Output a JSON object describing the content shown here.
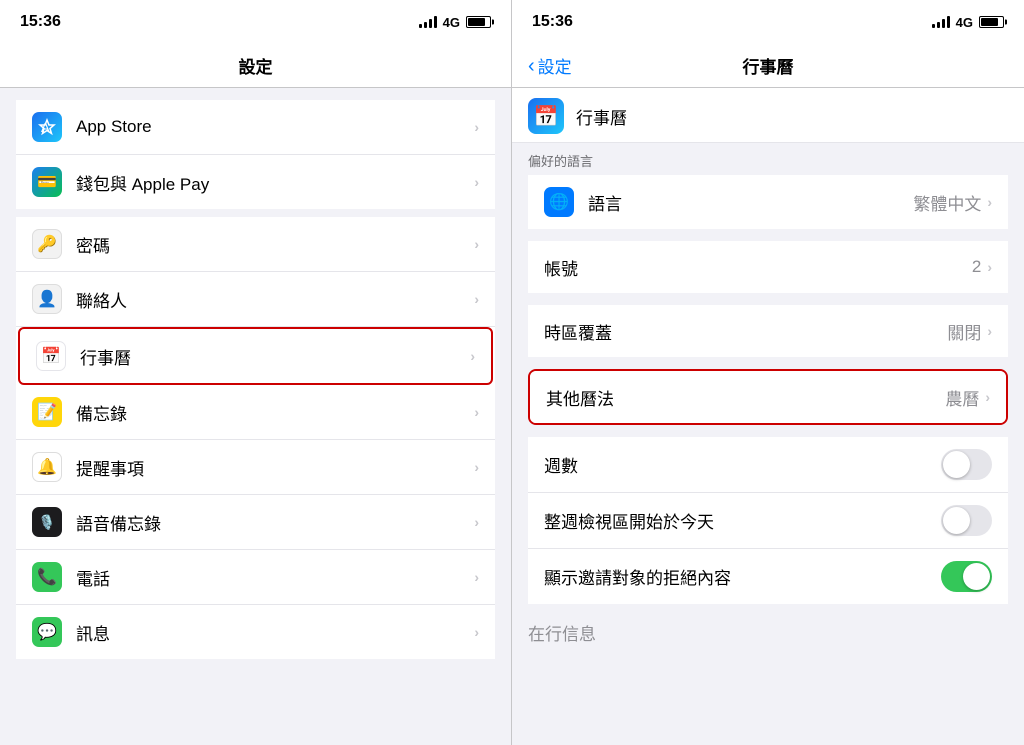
{
  "left": {
    "status": {
      "time": "15:36",
      "network": "4G"
    },
    "nav_title": "設定",
    "items_top": [
      {
        "id": "app-store",
        "label": "App Store",
        "icon_type": "appstore",
        "has_chevron": true
      },
      {
        "id": "wallet",
        "label": "錢包與 Apple Pay",
        "icon_type": "wallet",
        "has_chevron": true
      }
    ],
    "items_bottom": [
      {
        "id": "password",
        "label": "密碼",
        "icon_type": "password",
        "has_chevron": true
      },
      {
        "id": "contacts",
        "label": "聯絡人",
        "icon_type": "contacts",
        "has_chevron": true
      },
      {
        "id": "calendar",
        "label": "行事曆",
        "icon_type": "calendar",
        "has_chevron": true,
        "highlighted": true
      },
      {
        "id": "notes",
        "label": "備忘錄",
        "icon_type": "notes",
        "has_chevron": true
      },
      {
        "id": "reminders",
        "label": "提醒事項",
        "icon_type": "reminders",
        "has_chevron": true
      },
      {
        "id": "voice-memos",
        "label": "語音備忘錄",
        "icon_type": "voice",
        "has_chevron": true
      },
      {
        "id": "phone",
        "label": "電話",
        "icon_type": "phone",
        "has_chevron": true
      },
      {
        "id": "messages",
        "label": "訊息",
        "icon_type": "messages",
        "has_chevron": true
      }
    ]
  },
  "right": {
    "status": {
      "time": "15:36",
      "network": "4G"
    },
    "nav_back_label": "設定",
    "nav_title": "行事曆",
    "top_app_label": "行事曆",
    "section_preferred_lang": "偏好的語言",
    "items": [
      {
        "id": "language",
        "label": "語言",
        "value": "繁體中文",
        "icon_type": "globe",
        "has_chevron": true
      },
      {
        "id": "accounts",
        "label": "帳號",
        "value": "2",
        "has_chevron": true
      },
      {
        "id": "timezone-override",
        "label": "時區覆蓋",
        "value": "關閉",
        "has_chevron": true
      },
      {
        "id": "other-calendar",
        "label": "其他曆法",
        "value": "農曆",
        "has_chevron": true,
        "highlighted": true
      },
      {
        "id": "week-numbers",
        "label": "週數",
        "toggle": true,
        "toggle_on": false
      },
      {
        "id": "week-start",
        "label": "整週檢視區開始於今天",
        "toggle": true,
        "toggle_on": false
      },
      {
        "id": "show-invitee",
        "label": "顯示邀請對象的拒絕內容",
        "toggle": true,
        "toggle_on": true
      }
    ],
    "bottom_label": "在行信息"
  }
}
